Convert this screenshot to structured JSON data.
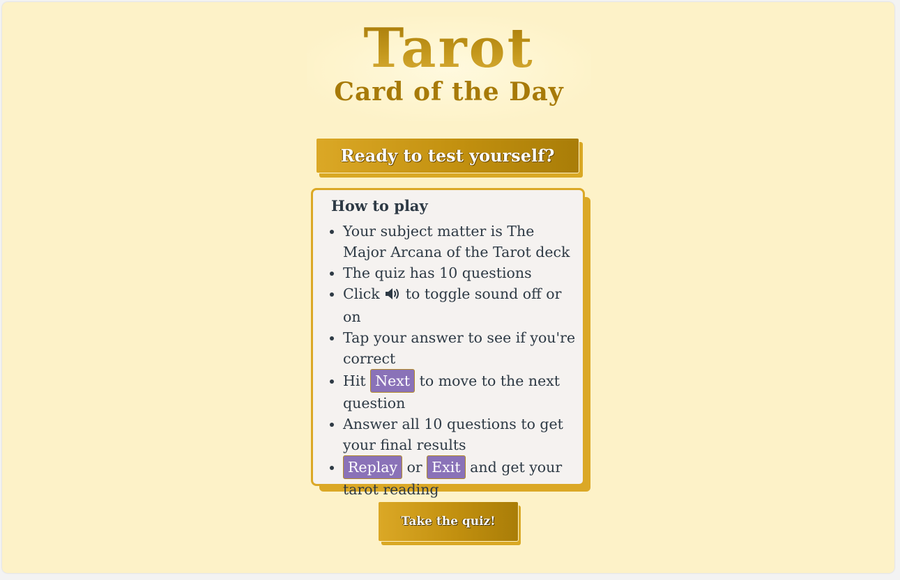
{
  "logo": {
    "title": "Tarot",
    "subtitle": "Card of the Day"
  },
  "banner": {
    "text": "Ready to test yourself?"
  },
  "howto": {
    "heading": "How to play",
    "items": [
      {
        "text": "Your subject matter is The Major Arcana of the Tarot deck"
      },
      {
        "text": "The quiz has 10 questions"
      },
      {
        "before": "Click",
        "icon": "speaker-icon",
        "after": "to toggle sound off or on"
      },
      {
        "text": "Tap your answer to see if you're correct"
      },
      {
        "before": "Hit",
        "button": "Next",
        "after": "to move to the next question"
      },
      {
        "text": "Answer all 10 questions to get your final results"
      },
      {
        "button1": "Replay",
        "middle": "or",
        "button2": "Exit",
        "after": "and get your tarot reading"
      }
    ]
  },
  "actions": {
    "take_quiz_label": "Take the quiz!"
  },
  "colors": {
    "background": "#fdf2c8",
    "gold": "#dba826",
    "gold_dark": "#a97d08",
    "purple": "#8a72b8",
    "card_bg": "#f5f2f0",
    "text": "#2e3a45"
  }
}
